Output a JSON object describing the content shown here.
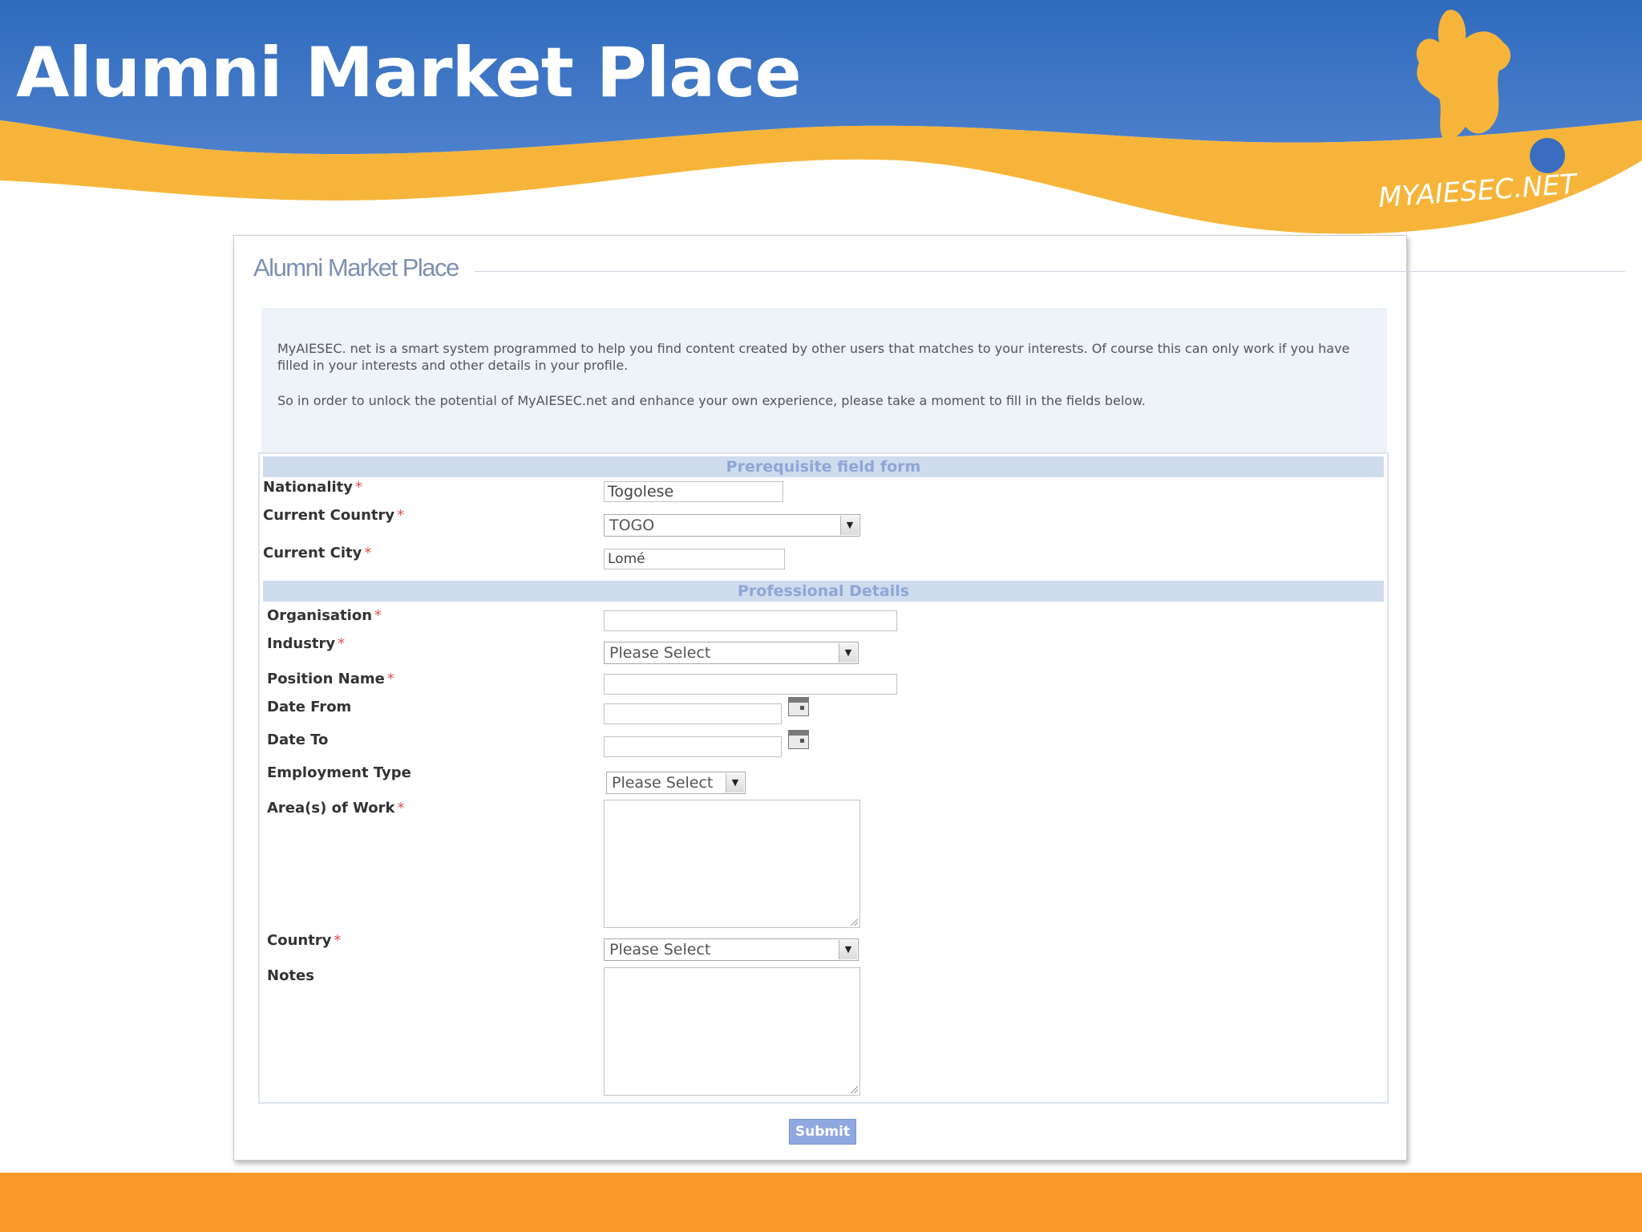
{
  "slide": {
    "title": "Alumni Market Place",
    "logo_text": "MYAIESEC.NET"
  },
  "colors": {
    "banner_blue": "#3f72c0",
    "wave_orange": "#f6b53a",
    "bottom_bar": "#fb9a2c",
    "section_header_bg": "#cfdcee",
    "section_header_text": "#8fa5d6",
    "submit_bg": "#8fa8e0"
  },
  "page": {
    "heading": "Alumni Market Place",
    "intro_p1": "MyAIESEC. net is a smart system programmed to help you find content created by other users that matches to your interests. Of course this can only work if you have filled in your interests and other details in your profile.",
    "intro_p2": "So in order to unlock the potential of MyAIESEC.net and enhance your own experience, please take a moment to fill in the fields below."
  },
  "prerequisite": {
    "title": "Prerequisite field form",
    "nationality_label": "Nationality",
    "nationality_value": "Togolese",
    "current_country_label": "Current Country",
    "current_country_value": "TOGO",
    "current_city_label": "Current City",
    "current_city_value": "Lomé"
  },
  "professional": {
    "title": "Professional Details",
    "organisation_label": "Organisation",
    "organisation_value": "",
    "industry_label": "Industry",
    "industry_value": "Please Select",
    "position_label": "Position Name",
    "position_value": "",
    "date_from_label": "Date From",
    "date_from_value": "",
    "date_to_label": "Date To",
    "date_to_value": "",
    "employment_type_label": "Employment Type",
    "employment_type_value": "Please Select",
    "areas_label": "Area(s) of Work",
    "country_label": "Country",
    "country_value": "Please Select",
    "notes_label": "Notes"
  },
  "required_marker": "*",
  "submit_label": "Submit"
}
